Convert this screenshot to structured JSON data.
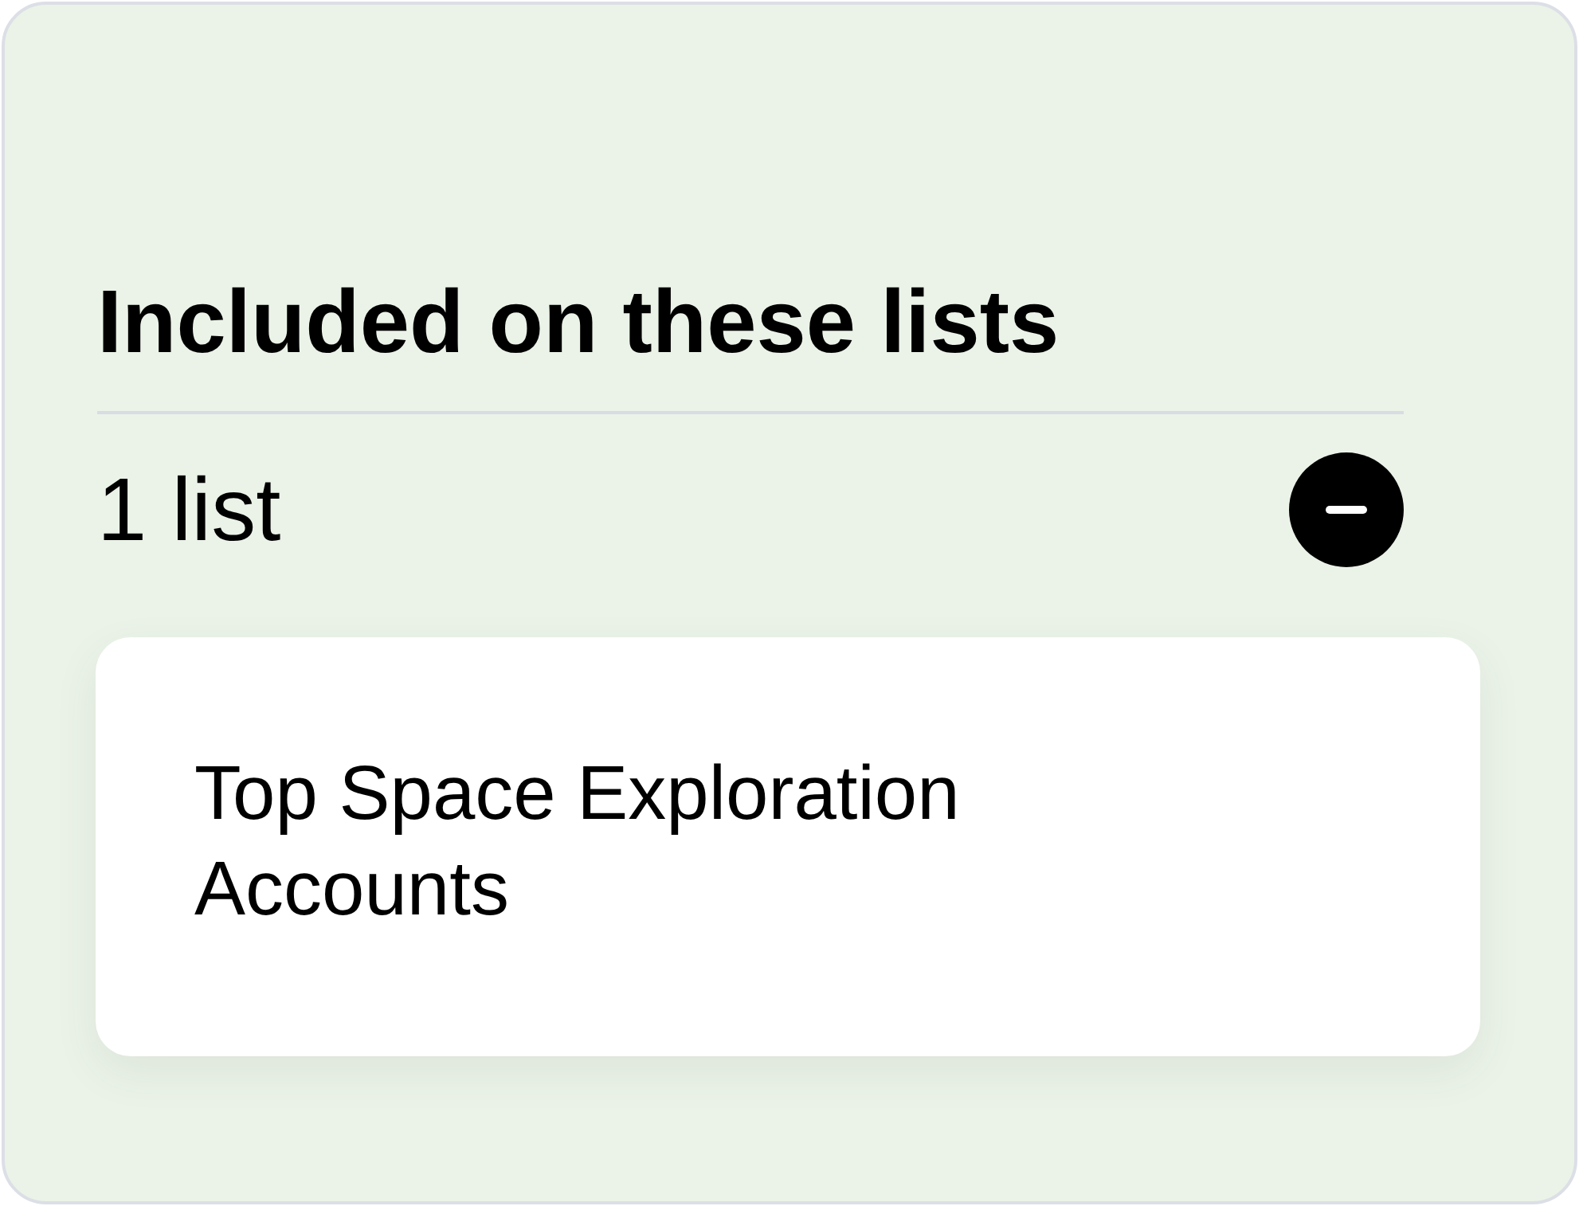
{
  "panel": {
    "title": "Included on these lists",
    "count": "1 list",
    "expanded": true,
    "lists": [
      {
        "name": "Top Space Exploration Accounts"
      }
    ]
  }
}
